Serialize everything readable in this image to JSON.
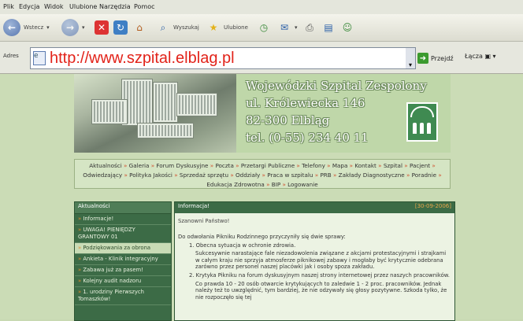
{
  "menu": [
    "Plik",
    "Edycja",
    "Widok",
    "Ulubione",
    "Narzędzia",
    "Pomoc"
  ],
  "toolbar": {
    "back_label": "Wstecz",
    "search_label": "Wyszukaj",
    "favorites_label": "Ulubione"
  },
  "address": {
    "label": "Adres",
    "url": "http://www.szpital.elblag.pl",
    "go_label": "Przejdź",
    "links_label": "Łącza"
  },
  "banner": {
    "line1": "Wojewódzki Szpital Zespolony",
    "line2": "ul. Królewiecka 146",
    "line3": "82-300 Elbląg",
    "line4": "tel. (0-55) 234 40 11"
  },
  "nav": {
    "row1": [
      "Aktualności",
      "Galeria",
      "Forum Dyskusyjne",
      "Poczta",
      "Przetargi Publiczne",
      "Telefony",
      "Mapa",
      "Kontakt",
      "Szpital",
      "Pacjent",
      "Odwiedzający",
      "Polityka Jakości",
      "Sprzedaż sprzętu",
      "Oddziały",
      "Praca w szpitalu",
      "PRB",
      "Zakłady Diagnostyczne",
      "Poradnie",
      "Edukacja Zdrowotna",
      "BIP",
      "Logowanie"
    ]
  },
  "sidebar": {
    "title": "Aktualności",
    "items": [
      {
        "label": "Informacje!",
        "highlight": false
      },
      {
        "label": "UWAGA! PIENIĘDZY GRANTOWY 01",
        "highlight": false
      },
      {
        "label": "Podziękowania za obrona",
        "highlight": true
      },
      {
        "label": "Ankieta - Klinik integracyjny",
        "highlight": false
      },
      {
        "label": "Zabawa już za pasem!",
        "highlight": false
      },
      {
        "label": "Kolejny audit nadzoru",
        "highlight": false
      },
      {
        "label": "1. urodziny Pierwszych Tomaszków!",
        "highlight": false
      }
    ]
  },
  "main": {
    "title": "Informacja!",
    "date": "[30-09-2006]",
    "greeting": "Szanowni Państwo!",
    "intro": "Do odwołania Pikniku Rodzinnego przyczyniły się dwie sprawy:",
    "p1a": "1. Obecna sytuacja w ochronie zdrowia.",
    "p1b": "Sukcesywnie narastające fale niezadowolenia związane z akcjami protestacyjnymi i strajkami w całym kraju nie sprzyja atmosferze piknikowej zabawy i mogłaby być krytycznie odebrana zarówno przez personel naszej placówki jak i osoby spoza zakładu.",
    "p2a": "2. Krytyka Pikniku na forum dyskusyjnym naszej strony internetowej przez naszych pracowników.",
    "p2b": "Co prawda 10 - 20 osób otwarcie krytykujących to zaledwie 1 - 2 proc. pracowników. Jednak należy też to uwzględnić, tym bardziej, że nie odzywały się głosy pozytywne. Szkoda tylko, że nie rozpoczęło się tej"
  }
}
